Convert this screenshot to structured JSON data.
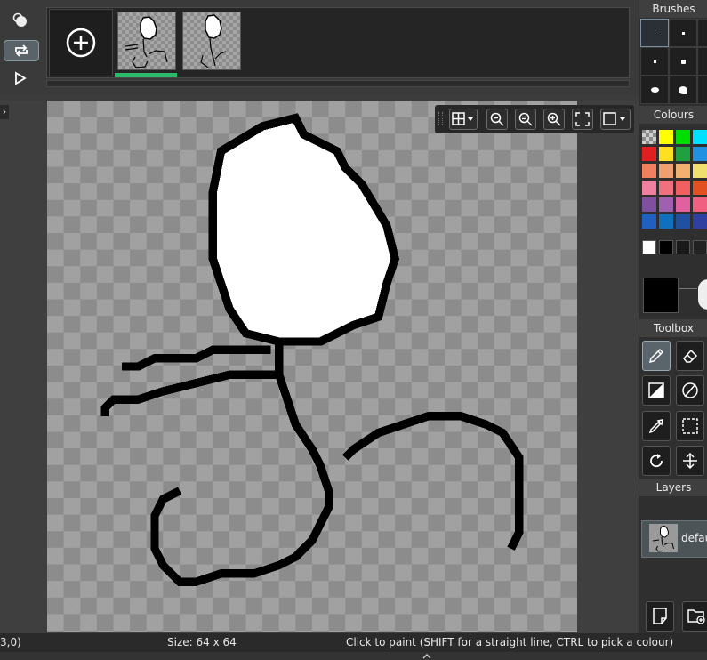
{
  "frames": {
    "add_label": "+",
    "count": 2,
    "selected_index": 0
  },
  "status": {
    "coords": "3,0)",
    "size": "Size: 64 x 64",
    "hint": "Click to paint (SHIFT for a straight line, CTRL to pick a colour)"
  },
  "panels": {
    "brushes_title": "Brushes",
    "colours_title": "Colours",
    "toolbox_title": "Toolbox",
    "layers_title": "Layers"
  },
  "layers": [
    {
      "name": "defau"
    }
  ],
  "palette": {
    "rows": [
      [
        "checker",
        "#ffff00",
        "#00dd00",
        "#00e0ff"
      ],
      [
        "#e02020",
        "#ffe020",
        "#20a040",
        "#2090e0"
      ],
      [
        "#f08060",
        "#f0a070",
        "#f0b070",
        "#f0e070"
      ],
      [
        "#f080a0",
        "#f07080",
        "#f06060",
        "#e05020"
      ],
      [
        "#8050a0",
        "#a060b0",
        "#e060a0",
        "#f06080"
      ],
      [
        "#2060c0",
        "#1070c0",
        "#2050a0",
        "#3040a0"
      ]
    ],
    "greys": [
      "#ffffff",
      "#000000",
      "#1a1a1a",
      "#222222"
    ],
    "primary_colour": "#000000"
  },
  "tools": [
    "pencil-icon",
    "eraser-icon",
    "fill-icon",
    "no-fill-icon",
    "eyedropper-icon",
    "select-icon",
    "rotate-icon",
    "flip-icon"
  ],
  "zoom_tools": [
    "grid-icon",
    "zoom-out-icon",
    "zoom-reset-icon",
    "zoom-in-icon",
    "fullscreen-icon",
    "frame-icon"
  ]
}
